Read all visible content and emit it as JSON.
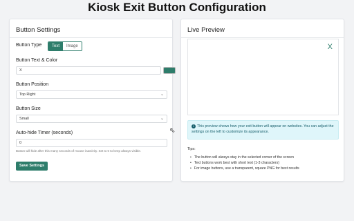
{
  "page": {
    "title": "Kiosk Exit Button Configuration"
  },
  "settings": {
    "title": "Button Settings",
    "button_type": {
      "label": "Button Type",
      "options": [
        "Text",
        "Image"
      ],
      "selected": "Text"
    },
    "text_color": {
      "label": "Button Text & Color",
      "value": "X",
      "color": "#2e7d6b"
    },
    "position": {
      "label": "Button Position",
      "value": "Top Right"
    },
    "size": {
      "label": "Button Size",
      "value": "Small"
    },
    "timer": {
      "label": "Auto-hide Timer (seconds)",
      "value": "0",
      "hint": "Button will hide after this many seconds of mouse inactivity. Set to 0 to keep always visible."
    },
    "save_label": "Save Settings"
  },
  "preview": {
    "title": "Live Preview",
    "button_text": "X",
    "info": "This preview shows how your exit button will appear on websites. You can adjust the settings on the left to customize its appearance.",
    "tips_title": "Tips:",
    "tips": [
      "The button will always stay in the selected corner of the screen",
      "Text buttons work best with short text (1-3 characters)",
      "For image buttons, use a transparent, square PNG for best results"
    ]
  },
  "colors": {
    "accent": "#2e7d6b",
    "info_bg": "#dff6fa",
    "background": "#f2f3f5"
  },
  "icons": {
    "info": "info-circle-icon",
    "dropdown": "chevron-down-icon",
    "cursor": "mouse-pointer-icon"
  }
}
